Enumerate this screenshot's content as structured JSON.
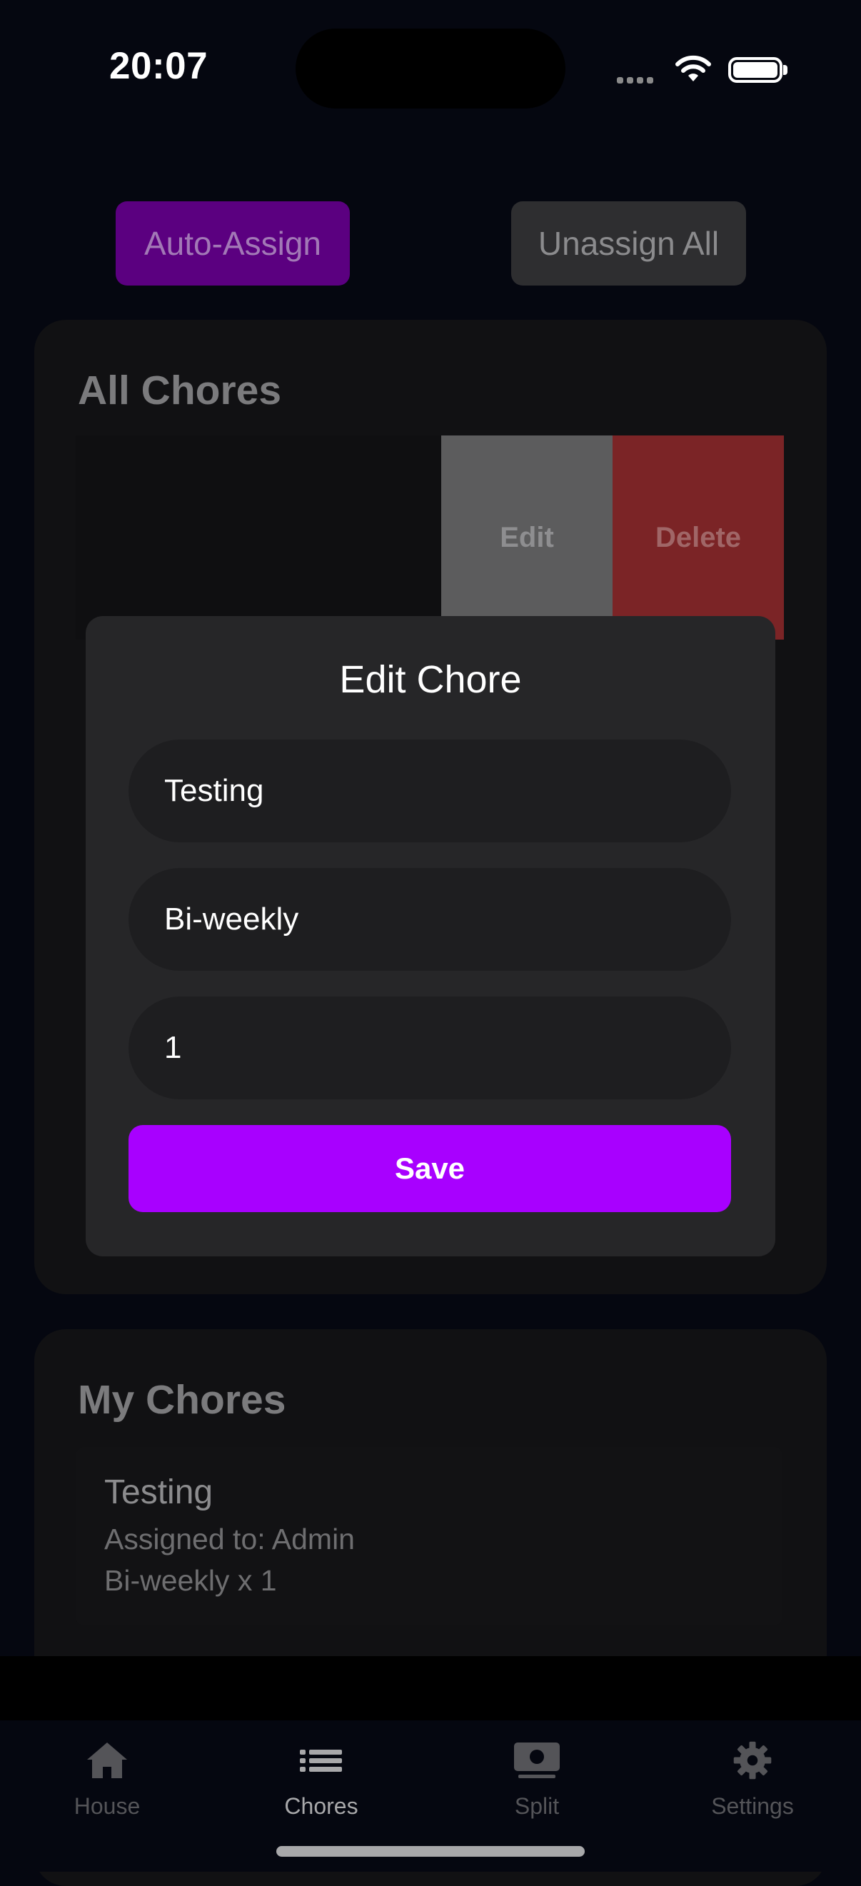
{
  "status_bar": {
    "time": "20:07"
  },
  "top_buttons": {
    "auto_assign": "Auto-Assign",
    "unassign_all": "Unassign All"
  },
  "all_chores": {
    "title": "All Chores",
    "swipe_actions": {
      "edit": "Edit",
      "delete": "Delete"
    }
  },
  "edit_modal": {
    "title": "Edit Chore",
    "name_value": "Testing",
    "frequency_value": "Bi-weekly",
    "quantity_value": "1",
    "save_label": "Save"
  },
  "my_chores": {
    "title": "My Chores",
    "items": [
      {
        "name": "Testing",
        "assigned": "Assigned to: Admin",
        "frequency": "Bi-weekly x 1"
      }
    ]
  },
  "tab_bar": {
    "items": [
      {
        "label": "House",
        "icon": "house-icon"
      },
      {
        "label": "Chores",
        "icon": "list-icon"
      },
      {
        "label": "Split",
        "icon": "money-icon"
      },
      {
        "label": "Settings",
        "icon": "gear-icon"
      }
    ],
    "active": "Chores"
  },
  "colors": {
    "background": "#050710",
    "accent": "#a800ff",
    "delete": "#7b2426",
    "card": "#111113",
    "modal": "#262628"
  }
}
